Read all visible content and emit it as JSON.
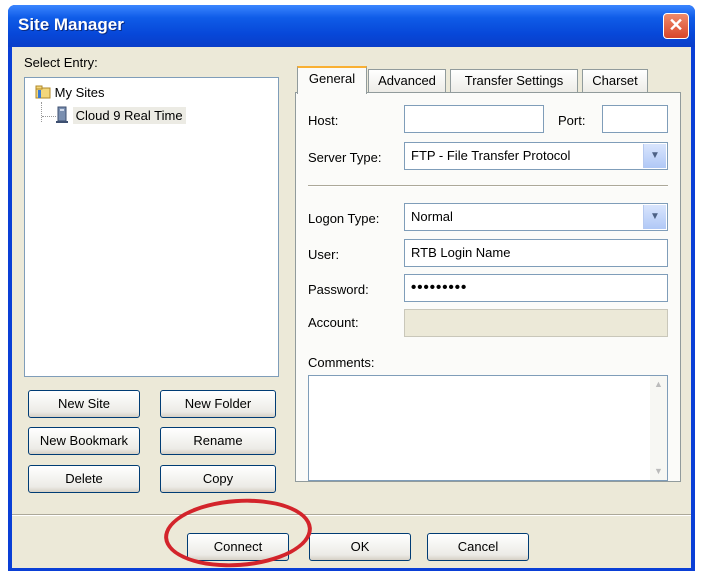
{
  "window": {
    "title": "Site Manager",
    "close_glyph": "✕"
  },
  "left": {
    "select_entry_label": "Select Entry:",
    "tree": {
      "root": "My Sites",
      "child": "Cloud 9 Real Time"
    },
    "buttons": {
      "new_site": "New Site",
      "new_folder": "New Folder",
      "new_bookmark": "New Bookmark",
      "rename": "Rename",
      "delete": "Delete",
      "copy": "Copy"
    }
  },
  "tabs": [
    "General",
    "Advanced",
    "Transfer Settings",
    "Charset"
  ],
  "general": {
    "host_label": "Host:",
    "host_value": "",
    "port_label": "Port:",
    "port_value": "",
    "server_type_label": "Server Type:",
    "server_type_value": "FTP - File Transfer Protocol",
    "logon_type_label": "Logon Type:",
    "logon_type_value": "Normal",
    "user_label": "User:",
    "user_value": "RTB Login Name",
    "password_label": "Password:",
    "password_value": "•••••••••",
    "account_label": "Account:",
    "account_value": "",
    "comments_label": "Comments:",
    "comments_value": ""
  },
  "footer": {
    "connect": "Connect",
    "ok": "OK",
    "cancel": "Cancel"
  },
  "colors": {
    "titlebar": "#0a3fd6",
    "dialog": "#ece9d8",
    "highlight_circle": "#d3242b"
  },
  "icons": [
    "folder-icon",
    "computer-icon",
    "dropdown-arrow-icon",
    "close-icon",
    "scroll-up-icon",
    "scroll-down-icon"
  ]
}
